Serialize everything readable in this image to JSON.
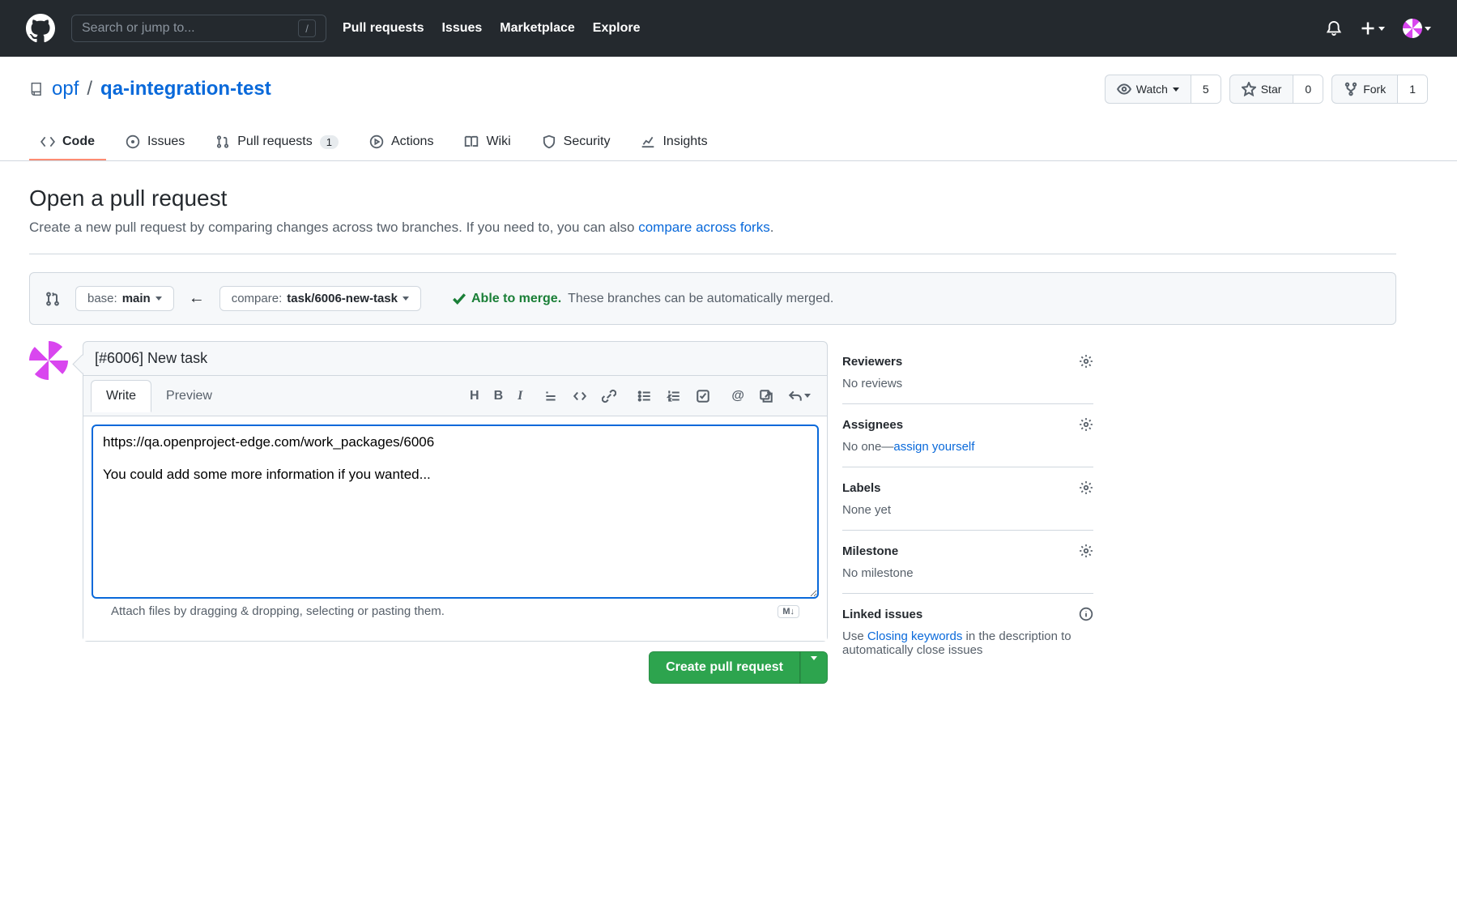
{
  "header": {
    "search_placeholder": "Search or jump to...",
    "nav": [
      "Pull requests",
      "Issues",
      "Marketplace",
      "Explore"
    ]
  },
  "repo": {
    "owner": "opf",
    "name": "qa-integration-test",
    "watch_label": "Watch",
    "watch_count": "5",
    "star_label": "Star",
    "star_count": "0",
    "fork_label": "Fork",
    "fork_count": "1"
  },
  "tabs": {
    "code": "Code",
    "issues": "Issues",
    "pulls": "Pull requests",
    "pulls_count": "1",
    "actions": "Actions",
    "wiki": "Wiki",
    "security": "Security",
    "insights": "Insights"
  },
  "page": {
    "title": "Open a pull request",
    "subtitle_pre": "Create a new pull request by comparing changes across two branches. If you need to, you can also ",
    "subtitle_link": "compare across forks",
    "subtitle_post": "."
  },
  "compare": {
    "base_label": "base: ",
    "base_value": "main",
    "compare_label": "compare: ",
    "compare_value": "task/6006-new-task",
    "able": "Able to merge.",
    "autotext": "These branches can be automatically merged."
  },
  "form": {
    "title_value": "[#6006] New task",
    "write_tab": "Write",
    "preview_tab": "Preview",
    "body": "https://qa.openproject-edge.com/work_packages/6006\n\nYou could add some more information if you wanted...",
    "attach_hint": "Attach files by dragging & dropping, selecting or pasting them.",
    "markdown_badge": "M↓",
    "submit_label": "Create pull request"
  },
  "sidebar": {
    "reviewers_title": "Reviewers",
    "reviewers_body": "No reviews",
    "assignees_title": "Assignees",
    "assignees_body_pre": "No one—",
    "assignees_link": "assign yourself",
    "labels_title": "Labels",
    "labels_body": "None yet",
    "milestone_title": "Milestone",
    "milestone_body": "No milestone",
    "linked_title": "Linked issues",
    "linked_body_pre": "Use ",
    "linked_link": "Closing keywords",
    "linked_body_post": " in the description to automatically close issues"
  }
}
